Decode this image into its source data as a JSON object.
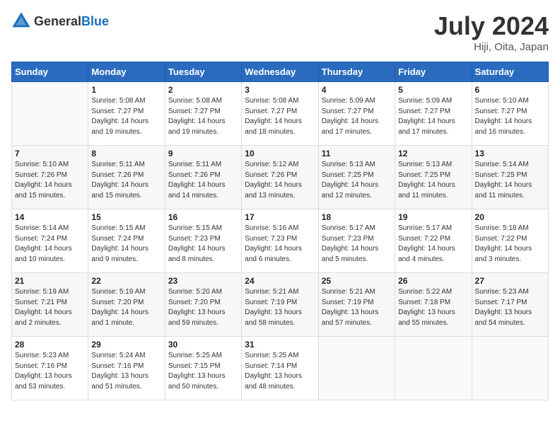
{
  "header": {
    "logo": {
      "text_general": "General",
      "text_blue": "Blue"
    },
    "title": "July 2024",
    "location": "Hiji, Oita, Japan"
  },
  "weekdays": [
    "Sunday",
    "Monday",
    "Tuesday",
    "Wednesday",
    "Thursday",
    "Friday",
    "Saturday"
  ],
  "weeks": [
    [
      {
        "day": "",
        "info": ""
      },
      {
        "day": "1",
        "info": "Sunrise: 5:08 AM\nSunset: 7:27 PM\nDaylight: 14 hours\nand 19 minutes."
      },
      {
        "day": "2",
        "info": "Sunrise: 5:08 AM\nSunset: 7:27 PM\nDaylight: 14 hours\nand 19 minutes."
      },
      {
        "day": "3",
        "info": "Sunrise: 5:08 AM\nSunset: 7:27 PM\nDaylight: 14 hours\nand 18 minutes."
      },
      {
        "day": "4",
        "info": "Sunrise: 5:09 AM\nSunset: 7:27 PM\nDaylight: 14 hours\nand 17 minutes."
      },
      {
        "day": "5",
        "info": "Sunrise: 5:09 AM\nSunset: 7:27 PM\nDaylight: 14 hours\nand 17 minutes."
      },
      {
        "day": "6",
        "info": "Sunrise: 5:10 AM\nSunset: 7:27 PM\nDaylight: 14 hours\nand 16 minutes."
      }
    ],
    [
      {
        "day": "7",
        "info": "Sunrise: 5:10 AM\nSunset: 7:26 PM\nDaylight: 14 hours\nand 15 minutes."
      },
      {
        "day": "8",
        "info": "Sunrise: 5:11 AM\nSunset: 7:26 PM\nDaylight: 14 hours\nand 15 minutes."
      },
      {
        "day": "9",
        "info": "Sunrise: 5:11 AM\nSunset: 7:26 PM\nDaylight: 14 hours\nand 14 minutes."
      },
      {
        "day": "10",
        "info": "Sunrise: 5:12 AM\nSunset: 7:26 PM\nDaylight: 14 hours\nand 13 minutes."
      },
      {
        "day": "11",
        "info": "Sunrise: 5:13 AM\nSunset: 7:25 PM\nDaylight: 14 hours\nand 12 minutes."
      },
      {
        "day": "12",
        "info": "Sunrise: 5:13 AM\nSunset: 7:25 PM\nDaylight: 14 hours\nand 11 minutes."
      },
      {
        "day": "13",
        "info": "Sunrise: 5:14 AM\nSunset: 7:25 PM\nDaylight: 14 hours\nand 11 minutes."
      }
    ],
    [
      {
        "day": "14",
        "info": "Sunrise: 5:14 AM\nSunset: 7:24 PM\nDaylight: 14 hours\nand 10 minutes."
      },
      {
        "day": "15",
        "info": "Sunrise: 5:15 AM\nSunset: 7:24 PM\nDaylight: 14 hours\nand 9 minutes."
      },
      {
        "day": "16",
        "info": "Sunrise: 5:15 AM\nSunset: 7:23 PM\nDaylight: 14 hours\nand 8 minutes."
      },
      {
        "day": "17",
        "info": "Sunrise: 5:16 AM\nSunset: 7:23 PM\nDaylight: 14 hours\nand 6 minutes."
      },
      {
        "day": "18",
        "info": "Sunrise: 5:17 AM\nSunset: 7:23 PM\nDaylight: 14 hours\nand 5 minutes."
      },
      {
        "day": "19",
        "info": "Sunrise: 5:17 AM\nSunset: 7:22 PM\nDaylight: 14 hours\nand 4 minutes."
      },
      {
        "day": "20",
        "info": "Sunrise: 5:18 AM\nSunset: 7:22 PM\nDaylight: 14 hours\nand 3 minutes."
      }
    ],
    [
      {
        "day": "21",
        "info": "Sunrise: 5:19 AM\nSunset: 7:21 PM\nDaylight: 14 hours\nand 2 minutes."
      },
      {
        "day": "22",
        "info": "Sunrise: 5:19 AM\nSunset: 7:20 PM\nDaylight: 14 hours\nand 1 minute."
      },
      {
        "day": "23",
        "info": "Sunrise: 5:20 AM\nSunset: 7:20 PM\nDaylight: 13 hours\nand 59 minutes."
      },
      {
        "day": "24",
        "info": "Sunrise: 5:21 AM\nSunset: 7:19 PM\nDaylight: 13 hours\nand 58 minutes."
      },
      {
        "day": "25",
        "info": "Sunrise: 5:21 AM\nSunset: 7:19 PM\nDaylight: 13 hours\nand 57 minutes."
      },
      {
        "day": "26",
        "info": "Sunrise: 5:22 AM\nSunset: 7:18 PM\nDaylight: 13 hours\nand 55 minutes."
      },
      {
        "day": "27",
        "info": "Sunrise: 5:23 AM\nSunset: 7:17 PM\nDaylight: 13 hours\nand 54 minutes."
      }
    ],
    [
      {
        "day": "28",
        "info": "Sunrise: 5:23 AM\nSunset: 7:16 PM\nDaylight: 13 hours\nand 53 minutes."
      },
      {
        "day": "29",
        "info": "Sunrise: 5:24 AM\nSunset: 7:16 PM\nDaylight: 13 hours\nand 51 minutes."
      },
      {
        "day": "30",
        "info": "Sunrise: 5:25 AM\nSunset: 7:15 PM\nDaylight: 13 hours\nand 50 minutes."
      },
      {
        "day": "31",
        "info": "Sunrise: 5:25 AM\nSunset: 7:14 PM\nDaylight: 13 hours\nand 48 minutes."
      },
      {
        "day": "",
        "info": ""
      },
      {
        "day": "",
        "info": ""
      },
      {
        "day": "",
        "info": ""
      }
    ]
  ]
}
